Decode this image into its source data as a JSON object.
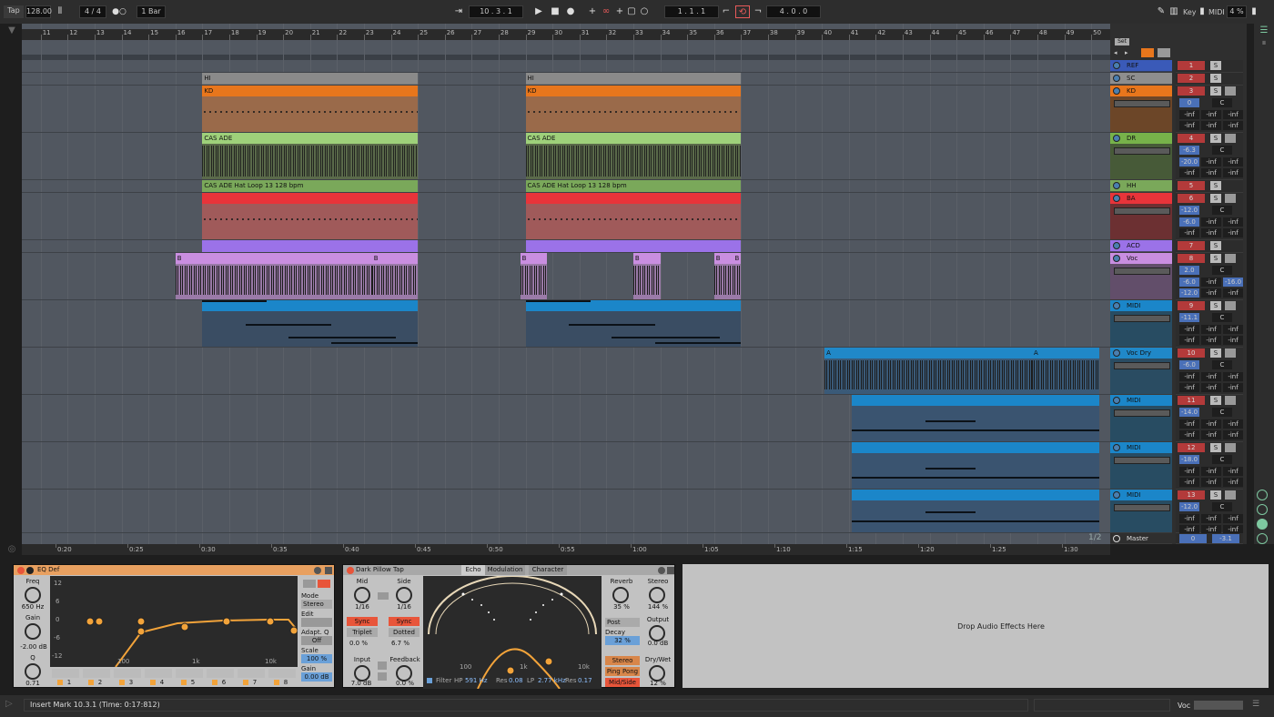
{
  "transport": {
    "tap": "Tap",
    "tempo": "128.00",
    "signature": "4 / 4",
    "quantize": "1 Bar",
    "position": "10 .  3 .  1",
    "loop_start": "1 .  1 .  1",
    "loop_length": "4 .  0 .  0",
    "key": "Key",
    "midi": "MIDI",
    "cpu": "4 %"
  },
  "ruler": {
    "bars": [
      "11",
      "12",
      "13",
      "14",
      "15",
      "16",
      "17",
      "18",
      "19",
      "20",
      "21",
      "22",
      "23",
      "24",
      "25",
      "26",
      "27",
      "28",
      "29",
      "30",
      "31",
      "32",
      "33",
      "34",
      "35",
      "36",
      "37",
      "38",
      "39",
      "40",
      "41",
      "42",
      "43",
      "44",
      "45",
      "46",
      "47",
      "48",
      "49",
      "50"
    ],
    "times": [
      "0:20",
      "0:25",
      "0:30",
      "0:35",
      "0:40",
      "0:45",
      "0:50",
      "0:55",
      "1:00",
      "1:05",
      "1:10",
      "1:15",
      "1:20",
      "1:25",
      "1:30"
    ]
  },
  "set_label": "Set",
  "page_indicator": "1/2",
  "clips": {
    "hi": "HI",
    "kd": "KD",
    "cas": "CAS ADE",
    "hat": "CAS ADE Hat Loop 13 128 bpm",
    "b": "B",
    "a": "A"
  },
  "tracks": [
    {
      "name": "REF",
      "num": "1",
      "color": "#3a5ab8"
    },
    {
      "name": "SC",
      "num": "2",
      "color": "#8e8e8e"
    },
    {
      "name": "KD",
      "num": "3",
      "color": "#e8761c",
      "vol": "0",
      "pan": "C"
    },
    {
      "name": "DR",
      "num": "4",
      "color": "#77b24a",
      "vol": "-6.3",
      "pan": "C",
      "send": "-20.0"
    },
    {
      "name": "HH",
      "num": "5",
      "color": "#7aa85a"
    },
    {
      "name": "BA",
      "num": "6",
      "color": "#e8343a",
      "vol": "-12.0",
      "pan": "C",
      "send": "-6.0"
    },
    {
      "name": "ACD",
      "num": "7",
      "color": "#9b72e8"
    },
    {
      "name": "Voc",
      "num": "8",
      "color": "#c98ee0",
      "vol": "2.0",
      "pan": "C",
      "send": "-6.0",
      "send2": "-16.0",
      "send3": "-12.0"
    },
    {
      "name": "MIDI",
      "num": "9",
      "color": "#1b86c9",
      "vol": "-11.1",
      "pan": "C"
    },
    {
      "name": "Voc Dry",
      "num": "10",
      "color": "#2088c8",
      "vol": "-6.0",
      "pan": "C"
    },
    {
      "name": "MIDI",
      "num": "11",
      "color": "#1b86c9",
      "vol": "-14.0",
      "pan": "C"
    },
    {
      "name": "MIDI",
      "num": "12",
      "color": "#1b86c9",
      "vol": "-18.0",
      "pan": "C"
    },
    {
      "name": "MIDI",
      "num": "13",
      "color": "#1b86c9",
      "vol": "-12.0",
      "pan": "C"
    }
  ],
  "master": {
    "name": "Master",
    "vol": "0",
    "pan": "-3.1"
  },
  "inf": "-inf",
  "solo": "S",
  "center": "C",
  "eq": {
    "title": "EQ Def",
    "freq_label": "Freq",
    "freq": "650 Hz",
    "gain_label": "Gain",
    "gain": "-2.00 dB",
    "q_label": "Q",
    "q": "0.71",
    "mode_label": "Mode",
    "mode": "Stereo",
    "edit": "Edit",
    "adapt": "Adapt. Q",
    "adapt_val": "Off",
    "scale_label": "Scale",
    "scale": "100 %",
    "gain2_label": "Gain",
    "gain2": "0.00 dB",
    "db_marks": [
      "12",
      "6",
      "0",
      "-6",
      "-12"
    ],
    "freq_marks": [
      "100",
      "1k",
      "10k"
    ],
    "bands": [
      "1",
      "2",
      "3",
      "4",
      "5",
      "6",
      "7",
      "8"
    ]
  },
  "echo": {
    "title": "Dark Pillow Tap",
    "tabs": [
      "Echo",
      "Modulation",
      "Character"
    ],
    "mid": "Mid",
    "side": "Side",
    "mid_val": "1/16",
    "side_val": "1/16",
    "sync": "Sync",
    "triplet": "Triplet",
    "dotted": "Dotted",
    "off1": "0.0 %",
    "off2": "6.7 %",
    "input": "Input",
    "input_val": "7.0 dB",
    "feedback": "Feedback",
    "feedback_val": "0.0 %",
    "reverb": "Reverb",
    "reverb_val": "35 %",
    "stereo": "Stereo",
    "stereo_val": "144 %",
    "post": "Post",
    "decay": "Decay",
    "decay_val": "32 %",
    "output": "Output",
    "output_val": "0.0 dB",
    "stereo_btn": "Stereo",
    "pingpong": "Ping Pong",
    "midside": "Mid/Side",
    "drywet": "Dry/Wet",
    "drywet_val": "12 %",
    "filter": "Filter",
    "hp": "HP",
    "hp_val": "591 Hz",
    "res": "Res",
    "res1": "0.08",
    "lp": "LP",
    "lp_val": "2.77 kHz",
    "res2": "0.17",
    "freq_marks": [
      "100",
      "1k",
      "10k"
    ]
  },
  "drop_text": "Drop Audio Effects Here",
  "status": "Insert Mark 10.3.1 (Time: 0:17:812)",
  "status_track": "Voc"
}
